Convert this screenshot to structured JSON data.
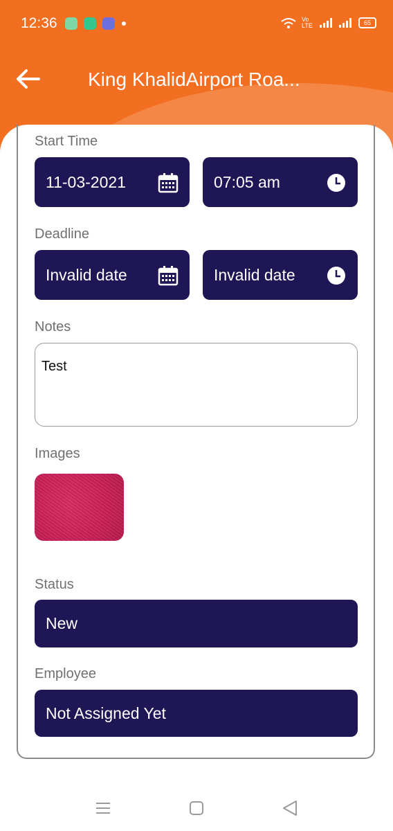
{
  "status_bar": {
    "time": "12:36",
    "volte": "Vo LTE",
    "battery": "65"
  },
  "toolbar": {
    "title": "King KhalidAirport Roa..."
  },
  "form": {
    "start_time": {
      "label": "Start Time",
      "date": "11-03-2021",
      "time": "07:05 am"
    },
    "deadline": {
      "label": "Deadline",
      "date": "Invalid date",
      "time": "Invalid date"
    },
    "notes": {
      "label": "Notes",
      "value": "Test"
    },
    "images": {
      "label": "Images"
    },
    "status": {
      "label": "Status",
      "value": "New"
    },
    "employee": {
      "label": "Employee",
      "value": "Not Assigned Yet"
    }
  },
  "colors": {
    "header": "#f26f22",
    "field_bg": "#1f1656",
    "field_text": "#ffffff"
  },
  "icons": {
    "back": "arrow-left-icon",
    "date": "calendar-icon",
    "time": "clock-icon",
    "nav": [
      "menu-icon",
      "home-square-icon",
      "back-triangle-icon"
    ]
  }
}
